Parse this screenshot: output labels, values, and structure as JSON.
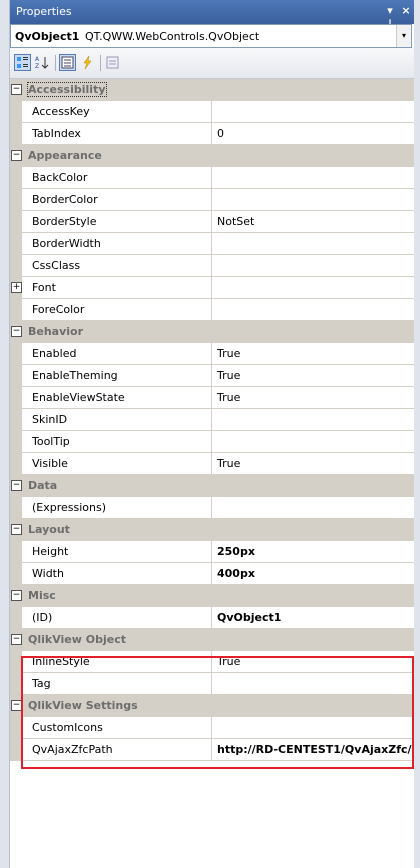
{
  "window": {
    "title": "Properties",
    "pin_icon": "▾ ⊥",
    "close_icon": "×"
  },
  "object_selector": {
    "name": "QvObject1",
    "type": "QT.QWW.WebControls.QvObject",
    "dropdown_icon": "▾"
  },
  "toolbar": {
    "categorized_icon": "categorized-icon",
    "alphabetical_icon": "alphabetical-icon",
    "properties_icon": "properties-icon",
    "events_icon": "events-icon",
    "property_pages_icon": "property-pages-icon"
  },
  "grid": {
    "accessibility": {
      "label": "Accessibility",
      "rows": [
        {
          "name": "AccessKey",
          "value": ""
        },
        {
          "name": "TabIndex",
          "value": "0"
        }
      ]
    },
    "appearance": {
      "label": "Appearance",
      "rows": [
        {
          "name": "BackColor",
          "value": ""
        },
        {
          "name": "BorderColor",
          "value": ""
        },
        {
          "name": "BorderStyle",
          "value": "NotSet"
        },
        {
          "name": "BorderWidth",
          "value": ""
        },
        {
          "name": "CssClass",
          "value": ""
        },
        {
          "name": "Font",
          "value": ""
        },
        {
          "name": "ForeColor",
          "value": ""
        }
      ]
    },
    "behavior": {
      "label": "Behavior",
      "rows": [
        {
          "name": "Enabled",
          "value": "True"
        },
        {
          "name": "EnableTheming",
          "value": "True"
        },
        {
          "name": "EnableViewState",
          "value": "True"
        },
        {
          "name": "SkinID",
          "value": ""
        },
        {
          "name": "ToolTip",
          "value": ""
        },
        {
          "name": "Visible",
          "value": "True"
        }
      ]
    },
    "data": {
      "label": "Data",
      "rows": [
        {
          "name": "(Expressions)",
          "value": ""
        }
      ]
    },
    "layout": {
      "label": "Layout",
      "rows": [
        {
          "name": "Height",
          "value": "250px"
        },
        {
          "name": "Width",
          "value": "400px"
        }
      ]
    },
    "misc": {
      "label": "Misc",
      "rows": [
        {
          "name": "(ID)",
          "value": "QvObject1"
        }
      ]
    },
    "qlikview_object": {
      "label": "QlikView Object",
      "rows": [
        {
          "name": "InlineStyle",
          "value": "True"
        },
        {
          "name": "Tag",
          "value": ""
        }
      ]
    },
    "qlikview_settings": {
      "label": "QlikView Settings",
      "rows": [
        {
          "name": "CustomIcons",
          "value": ""
        },
        {
          "name": "QvAjaxZfcPath",
          "value": "http://RD-CENTEST1/QvAjaxZfc/"
        }
      ]
    }
  },
  "colors": {
    "highlight_border": "#e0202a",
    "title_bar": "#3a5f9c",
    "category_bg": "#d4d0c8"
  }
}
